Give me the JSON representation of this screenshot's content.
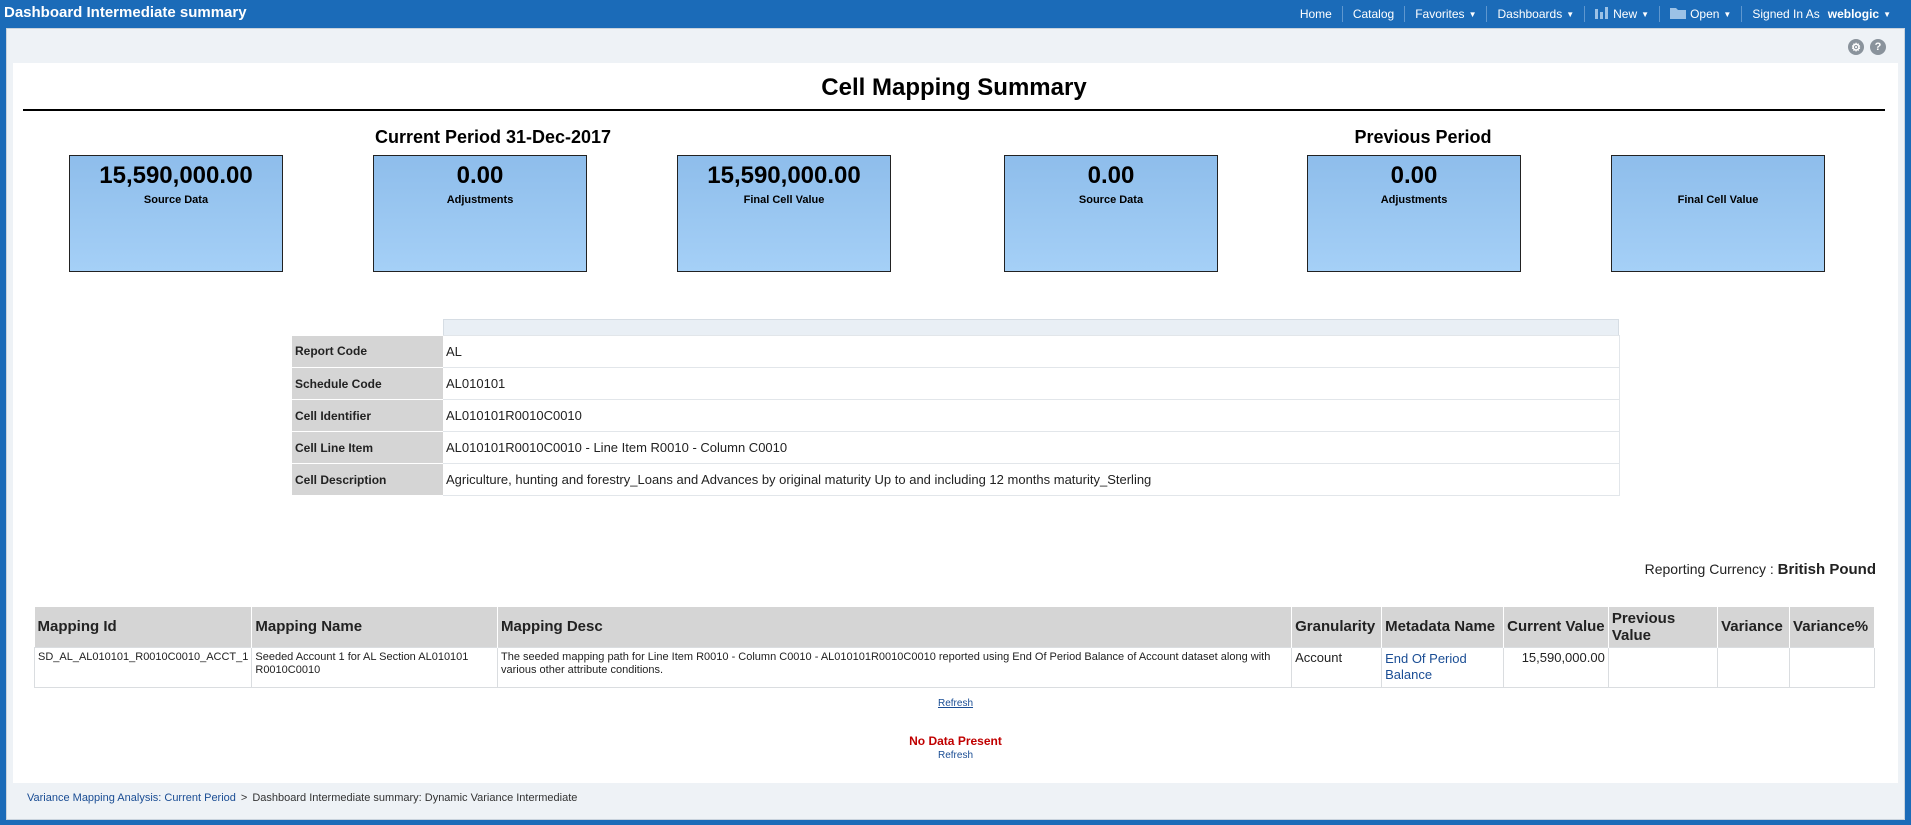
{
  "app": {
    "title": "Dashboard Intermediate summary"
  },
  "nav": {
    "home": "Home",
    "catalog": "Catalog",
    "favorites": "Favorites",
    "dashboards": "Dashboards",
    "new": "New",
    "open": "Open",
    "signed_in_as": "Signed In As",
    "user": "weblogic"
  },
  "page": {
    "title": "Cell Mapping Summary"
  },
  "current_period": {
    "title": "Current Period 31-Dec-2017",
    "source_data": {
      "value": "15,590,000.00",
      "label": "Source Data"
    },
    "adjustments": {
      "value": "0.00",
      "label": "Adjustments"
    },
    "final_cell_value": {
      "value": "15,590,000.00",
      "label": "Final Cell Value"
    }
  },
  "previous_period": {
    "title": "Previous Period",
    "source_data": {
      "value": "0.00",
      "label": "Source Data"
    },
    "adjustments": {
      "value": "0.00",
      "label": "Adjustments"
    },
    "final_cell_value": {
      "value": "",
      "label": "Final Cell Value"
    }
  },
  "details": {
    "report_code": {
      "label": "Report Code",
      "value": "AL"
    },
    "schedule_code": {
      "label": "Schedule Code",
      "value": "AL010101"
    },
    "cell_identifier": {
      "label": "Cell Identifier",
      "value": "AL010101R0010C0010"
    },
    "cell_line_item": {
      "label": "Cell Line Item",
      "value": "AL010101R0010C0010 - Line Item R0010 - Column C0010"
    },
    "cell_description": {
      "label": "Cell Description",
      "value": "Agriculture, hunting and forestry_Loans and Advances by original maturity Up to and including 12 months maturity_Sterling"
    }
  },
  "currency": {
    "label": "Reporting Currency :",
    "value": "British Pound"
  },
  "mapping": {
    "columns": {
      "mapping_id": "Mapping Id",
      "mapping_name": "Mapping Name",
      "mapping_desc": "Mapping Desc",
      "granularity": "Granularity",
      "metadata_name": "Metadata Name",
      "current_value": "Current Value",
      "previous_value": "Previous Value",
      "variance": "Variance",
      "variance_pct": "Variance%"
    },
    "rows": [
      {
        "mapping_id": "SD_AL_AL010101_R0010C0010_ACCT_1",
        "mapping_name": "Seeded Account 1 for AL Section AL010101 R0010C0010",
        "mapping_desc": "The seeded mapping path for Line Item R0010 - Column C0010 - AL010101R0010C0010 reported using End Of Period Balance of Account dataset along with various other attribute conditions.",
        "granularity": "Account",
        "metadata_name": "End Of Period Balance",
        "current_value": "15,590,000.00",
        "previous_value": "",
        "variance": "",
        "variance_pct": ""
      }
    ],
    "refresh": "Refresh"
  },
  "no_data": {
    "message": "No Data Present",
    "refresh": "Refresh"
  },
  "breadcrumb": {
    "link": "Variance Mapping Analysis: Current Period",
    "separator": ">",
    "current": "Dashboard Intermediate summary: Dynamic Variance Intermediate"
  }
}
